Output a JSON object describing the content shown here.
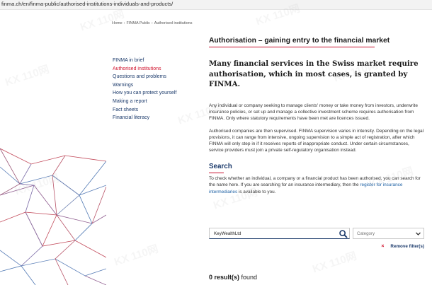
{
  "browser": {
    "url": "finma.ch/en/finma-public/authorised-institutions-individuals-and-products/"
  },
  "breadcrumb": {
    "items": [
      "Home",
      "FINMA Public",
      "Authorised institutions"
    ]
  },
  "sidebar": {
    "items": [
      {
        "label": "FINMA in brief",
        "active": false
      },
      {
        "label": "Authorised institutions",
        "active": true
      },
      {
        "label": "Questions and problems",
        "active": false
      },
      {
        "label": "Warnings",
        "active": false
      },
      {
        "label": "How you can protect yourself",
        "active": false
      },
      {
        "label": "Making a report",
        "active": false
      },
      {
        "label": "Fact sheets",
        "active": false
      },
      {
        "label": "Financial literacy",
        "active": false
      }
    ]
  },
  "main": {
    "title": "Authorisation – gaining entry to the financial market",
    "lead": "Many financial services in the Swiss market require authorisation, which in most cases, is granted by FINMA.",
    "paragraph1": "Any individual or company seeking to manage clients' money or take money from investors, underwrite insurance policies, or set up and manage a collective investment scheme requires authorisation from FINMA. Only where statutory requirements have been met are licences issued.",
    "paragraph2": "Authorised companies are then supervised. FINMA supervision varies in intensity. Depending on the legal provisions, it can range from intensive, ongoing supervision to a simple act of registration, after which FINMA will only step in if it receives reports of inappropriate conduct. Under certain circumstances, service providers must join a private self-regulatory organisation instead.",
    "search_title": "Search",
    "search_text_before": "To check whether an individual, a company or a financial product has been authorised, you can search for the name here. If you are searching for an insurance intermediary, then the ",
    "search_link": "register for insurance intermediaries",
    "search_text_after": " is available to you."
  },
  "search": {
    "value": "KeyWealthLtd",
    "category_placeholder": "Category",
    "remove_filters_label": "Remove filter(s)"
  },
  "results": {
    "count": "0 result(s)",
    "suffix": " found"
  },
  "watermark": {
    "text": "KX 110网"
  },
  "colors": {
    "accent_red": "#c8102e",
    "link_navy": "#1b3a6b",
    "active_red": "#d0112b"
  }
}
